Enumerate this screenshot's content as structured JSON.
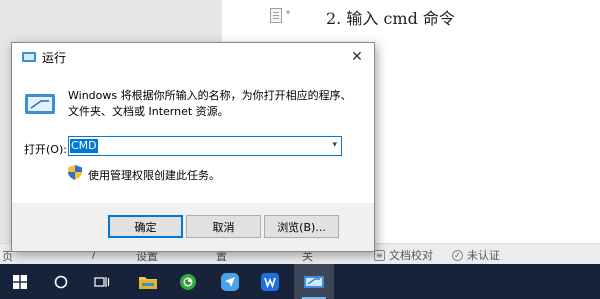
{
  "document": {
    "heading": "2. 输入 cmd 命令"
  },
  "statusbar": {
    "page_fragment": "页",
    "fragments": [
      "/",
      "设置",
      "置",
      "关"
    ],
    "proofread_label": "文档校对",
    "uncertified_label": "未认证"
  },
  "dialog": {
    "title": "运行",
    "description": "Windows 将根据你所输入的名称，为你打开相应的程序、文件夹、文档或 Internet 资源。",
    "open_label": "打开(O):",
    "input_value": "CMD",
    "admin_note": "使用管理权限创建此任务。",
    "buttons": {
      "ok": "确定",
      "cancel": "取消",
      "browse": "浏览(B)..."
    }
  },
  "taskbar": {
    "apps": [
      "start-icon",
      "cortana-icon",
      "task-view-icon",
      "file-explorer-icon",
      "browser-icon",
      "feishu-icon",
      "wps-icon",
      "run-icon"
    ]
  },
  "colors": {
    "accent": "#0078d7",
    "taskbar": "#17233a"
  }
}
